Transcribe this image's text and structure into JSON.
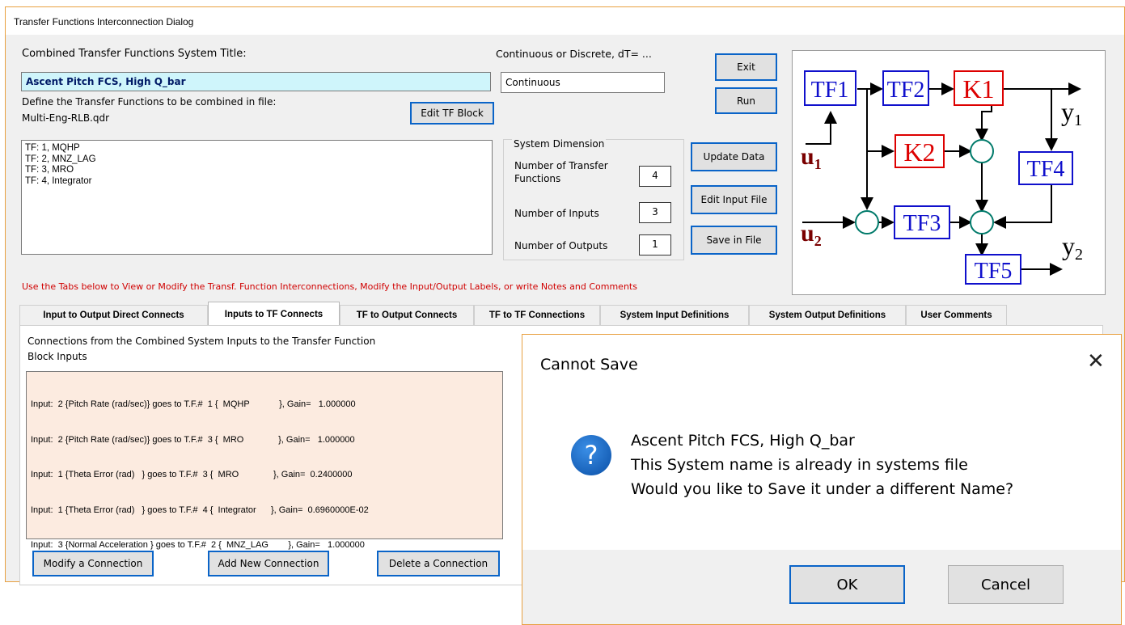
{
  "window": {
    "title": "Transfer Functions Interconnection Dialog"
  },
  "form": {
    "system_title_label": "Combined Transfer Functions System Title:",
    "system_title_value": "Ascent Pitch FCS, High Q_bar",
    "cont_disc_label": "Continuous or Discrete, dT= ...",
    "cont_disc_value": "Continuous",
    "define_tf_label": "Define the Transfer Functions to be combined in file:",
    "file_name": "Multi-Eng-RLB.qdr",
    "edit_tf_button": "Edit TF Block",
    "tf_list": [
      "TF: 1,  MQHP",
      "TF: 2,  MNZ_LAG",
      "TF: 3,  MRO",
      "TF: 4,  Integrator"
    ]
  },
  "system_dimension": {
    "group_label": "System Dimension",
    "num_tf_label": "Number of Transfer Functions",
    "num_tf": "4",
    "num_inputs_label": "Number of Inputs",
    "num_inputs": "3",
    "num_outputs_label": "Number of Outputs",
    "num_outputs": "1"
  },
  "buttons": {
    "exit": "Exit",
    "run": "Run",
    "update_data": "Update Data",
    "edit_input_file": "Edit Input File",
    "save_in_file": "Save in File"
  },
  "hint": "Use the Tabs below to View or Modify the Transf. Function Interconnections, Modify the Input/Output Labels, or write Notes and Comments",
  "tabs": [
    "Input to Output Direct Connects",
    "Inputs to TF Connects",
    "TF to Output Connects",
    "TF to TF Connections",
    "System Input Definitions",
    "System Output Definitions",
    "User Comments"
  ],
  "active_tab": "Inputs to TF Connects",
  "panel": {
    "heading_line1": "Connections from the Combined System Inputs to the Transfer Function",
    "heading_line2": "Block Inputs",
    "connections": [
      "Input:  2 {Pitch Rate (rad/sec)} goes to T.F.#  1 {  MQHP            }, Gain=   1.000000",
      "Input:  2 {Pitch Rate (rad/sec)} goes to T.F.#  3 {  MRO              }, Gain=   1.000000",
      "Input:  1 {Theta Error (rad)   } goes to T.F.#  3 {  MRO              }, Gain=  0.2400000",
      "Input:  1 {Theta Error (rad)   } goes to T.F.#  4 {  Integrator      }, Gain=  0.6960000E-02",
      "Input:  3 {Normal Acceleration } goes to T.F.#  2 {  MNZ_LAG        }, Gain=   1.000000"
    ],
    "modify_button": "Modify a Connection",
    "add_button": "Add New Connection",
    "delete_button": "Delete a Connection"
  },
  "diagram": {
    "blocks": [
      "TF1",
      "TF2",
      "K1",
      "K2",
      "TF4",
      "TF3",
      "TF5"
    ],
    "input_u1": "u",
    "input_u1_sub": "1",
    "input_u2": "u",
    "input_u2_sub": "2",
    "output_y1": "y",
    "output_y1_sub": "1",
    "output_y2": "y",
    "output_y2_sub": "2",
    "colors": {
      "tf": "#1010cc",
      "k": "#dd0000",
      "junction": "#007a6a",
      "u_label": "#7a0000"
    }
  },
  "dialog": {
    "title": "Cannot Save",
    "close_icon": "close-icon",
    "icon": "question-icon",
    "message_line1": "Ascent Pitch FCS, High Q_bar",
    "message_line2": "This System name is already in systems file",
    "message_line3": "Would you like to Save it under a different Name?",
    "ok": "OK",
    "cancel": "Cancel"
  }
}
